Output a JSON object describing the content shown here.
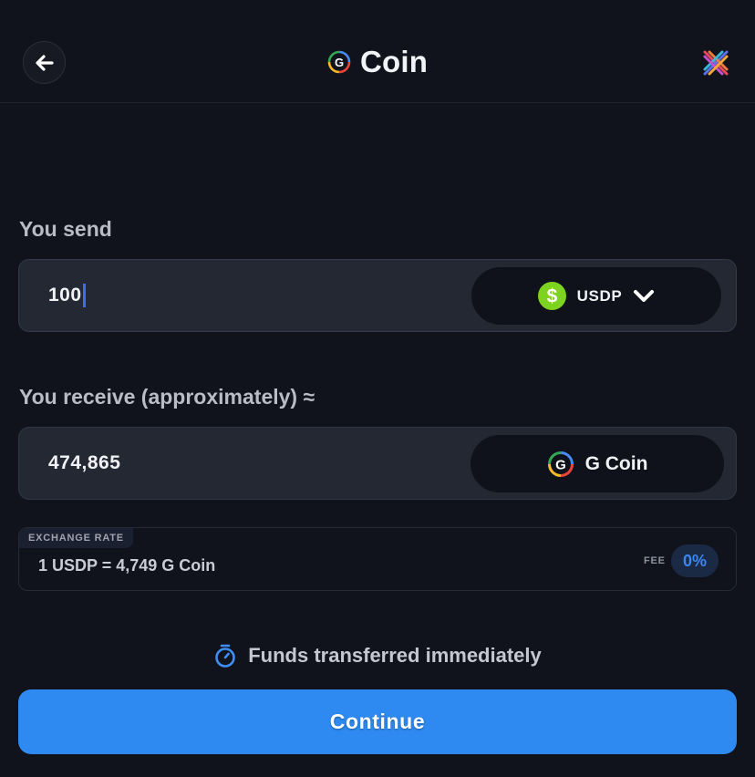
{
  "header": {
    "title": "Coin",
    "back_icon": "arrow-left-icon",
    "title_icon": "g-coin-icon",
    "brand_icon": "cross-logo-icon"
  },
  "send": {
    "label": "You send",
    "amount": "100",
    "token": "USDP",
    "token_icon": "dollar-coin-icon",
    "dropdown_icon": "chevron-down-icon"
  },
  "receive": {
    "label": "You receive (approximately) ≈",
    "amount": "474,865",
    "token": "G Coin",
    "token_icon": "g-coin-icon"
  },
  "exchange": {
    "label": "EXCHANGE RATE",
    "rate": "1 USDP = 4,749 G Coin",
    "fee_label": "FEE",
    "fee_value": "0%"
  },
  "info": {
    "text": "Funds transferred immediately",
    "icon": "stopwatch-icon"
  },
  "continue": {
    "label": "Continue"
  },
  "colors": {
    "background": "#10131b",
    "card": "#232833",
    "accent": "#2e8af0",
    "usdp_green": "#7ed321",
    "fee_blue": "#3d86f2"
  }
}
